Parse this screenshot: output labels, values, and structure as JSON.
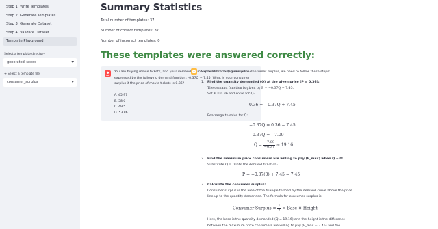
{
  "sidebar": {
    "nav": [
      {
        "label": "Step 1: Write Templates",
        "active": false
      },
      {
        "label": "Step 2: Generate Templates",
        "active": false
      },
      {
        "label": "Step 3: Generate Dataset",
        "active": false
      },
      {
        "label": "Step 4: Validate Dataset",
        "active": false
      },
      {
        "label": "Template Playground",
        "active": true
      }
    ],
    "directory_label": "Select a template directory",
    "directory_value": "generated_seeds",
    "file_label": "→  Select a template file",
    "file_value": "consumer_surplus"
  },
  "main": {
    "title": "Summary Statistics",
    "total": "Total number of templates: 37",
    "correct": "Number of correct templates: 37",
    "incorrect": "Number of incorrect templates: 0",
    "section_title": "These templates were answered correctly:"
  },
  "question": {
    "text": "You are buying movie tickets, and your demand for movie tickets at any given price is expressed by the following demand function: -0.37Q + 7.45. What is your consumer surplus if the price of movie tickets is 0.36?",
    "options": [
      "A. 45.97",
      "B. 58.0",
      "C. 49.5",
      "D. 53.86"
    ]
  },
  "answer": {
    "intro": "Explanation: To determine the consumer surplus, we need to follow these steps:",
    "step1_num": "1.",
    "step1_title": "Find the quantity demanded (Q) at the given price (P = 0.36):",
    "step1_line1": "The demand function is given by P = −0.37Q + 7.45.",
    "step1_line2": "Set P = 0.36 and solve for Q:",
    "eq1": "0.36 = −0.37Q + 7.45",
    "rearrange": "Rearrange to solve for Q:",
    "eq2a": "−0.37Q = 0.36 − 7.45",
    "eq2b": "−0.37Q = −7.09",
    "eq2c_lhs": "Q = ",
    "eq2c_num": "−7.09",
    "eq2c_den": "−0.37",
    "eq2c_rhs": " ≈ 19.16",
    "step2_num": "2.",
    "step2_title": "Find the maximum price consumers are willing to pay (P_max) when Q = 0:",
    "step2_line1": "Substitute Q = 0 into the demand function:",
    "eq3": "P = −0.37(0) + 7.45 = 7.45",
    "step3_num": "3.",
    "step3_title": "Calculate the consumer surplus:",
    "step3_line1": "Consumer surplus is the area of the triangle formed by the demand curve above the price line up to the quantity demanded. The formula for consumer surplus is:",
    "eq4_lhs": "Consumer Surplus = ",
    "eq4_num": "1",
    "eq4_den": "2",
    "eq4_rhs": " × Base × Height",
    "step3_line2": "Here, the base is the quantity demanded (Q = 19.16) and the height is the difference between the maximum price consumers are willing to pay (P_max = 7.45) and the"
  }
}
